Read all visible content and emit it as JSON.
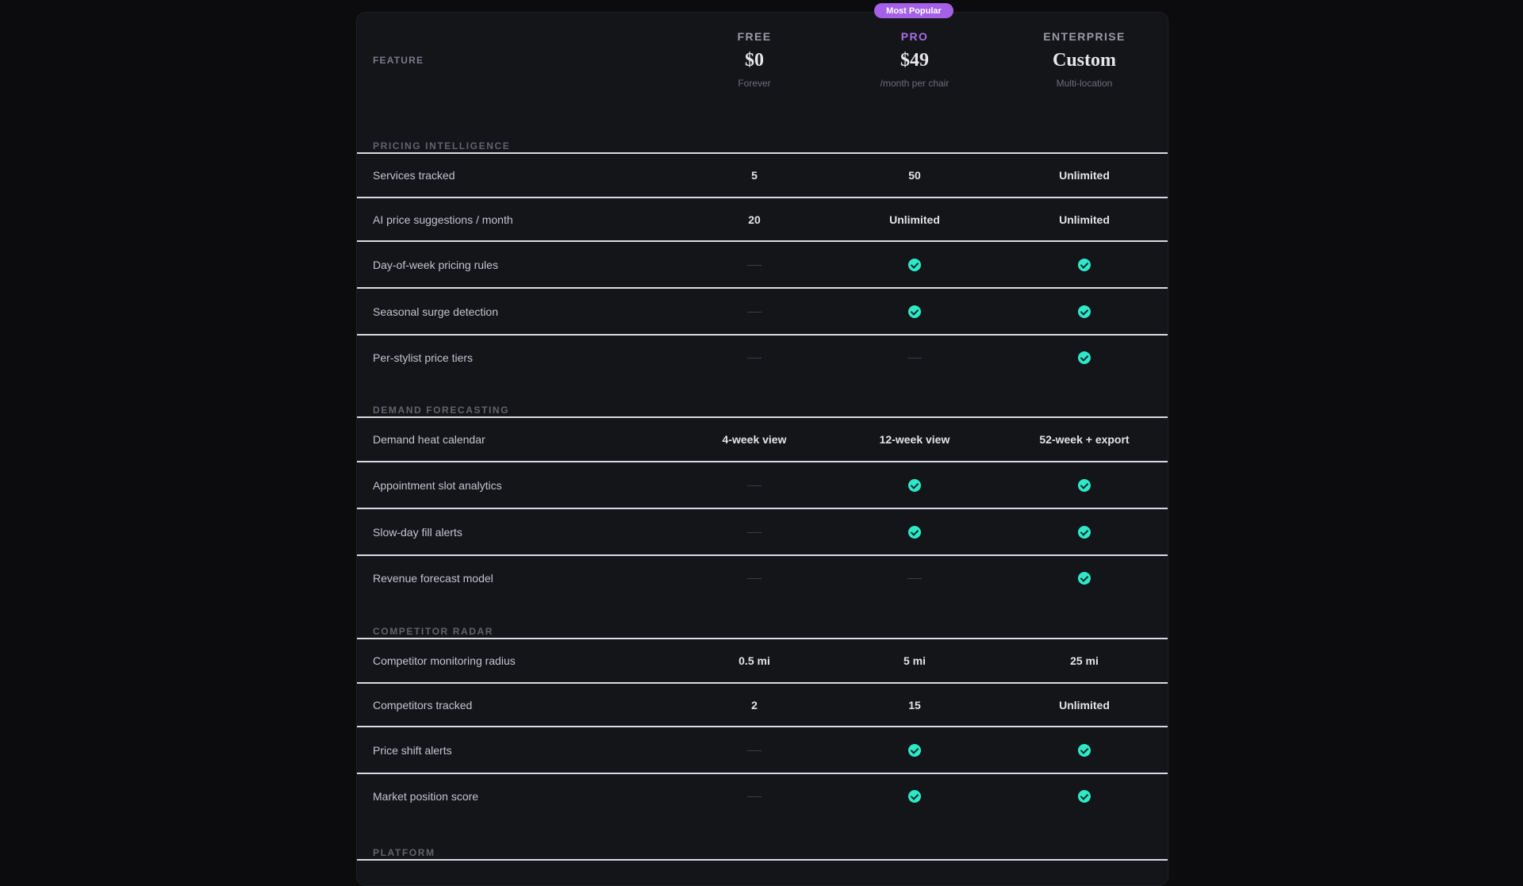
{
  "badge": "Most Popular",
  "header": {
    "feature_label": "FEATURE",
    "plans": [
      {
        "name": "FREE",
        "price": "$0",
        "sub": "Forever"
      },
      {
        "name": "PRO",
        "price": "$49",
        "sub": "/month per chair"
      },
      {
        "name": "ENTERPRISE",
        "price": "Custom",
        "sub": "Multi-location"
      }
    ]
  },
  "sections": [
    {
      "title": "PRICING INTELLIGENCE",
      "rows": [
        {
          "feature": "Services tracked",
          "values": [
            "5",
            "50",
            "Unlimited"
          ]
        },
        {
          "feature": "AI price suggestions / month",
          "values": [
            "20",
            "Unlimited",
            "Unlimited"
          ]
        },
        {
          "feature": "Day-of-week pricing rules",
          "values": [
            "no",
            "yes",
            "yes"
          ]
        },
        {
          "feature": "Seasonal surge detection",
          "values": [
            "no",
            "yes",
            "yes"
          ]
        },
        {
          "feature": "Per-stylist price tiers",
          "values": [
            "no",
            "no",
            "yes"
          ]
        }
      ]
    },
    {
      "title": "DEMAND FORECASTING",
      "rows": [
        {
          "feature": "Demand heat calendar",
          "values": [
            "4-week view",
            "12-week view",
            "52-week + export"
          ]
        },
        {
          "feature": "Appointment slot analytics",
          "values": [
            "no",
            "yes",
            "yes"
          ]
        },
        {
          "feature": "Slow-day fill alerts",
          "values": [
            "no",
            "yes",
            "yes"
          ]
        },
        {
          "feature": "Revenue forecast model",
          "values": [
            "no",
            "no",
            "yes"
          ]
        }
      ]
    },
    {
      "title": "COMPETITOR RADAR",
      "rows": [
        {
          "feature": "Competitor monitoring radius",
          "values": [
            "0.5 mi",
            "5 mi",
            "25 mi"
          ]
        },
        {
          "feature": "Competitors tracked",
          "values": [
            "2",
            "15",
            "Unlimited"
          ]
        },
        {
          "feature": "Price shift alerts",
          "values": [
            "no",
            "yes",
            "yes"
          ]
        },
        {
          "feature": "Market position score",
          "values": [
            "no",
            "yes",
            "yes"
          ]
        }
      ]
    },
    {
      "title": "PLATFORM",
      "rows": []
    }
  ]
}
